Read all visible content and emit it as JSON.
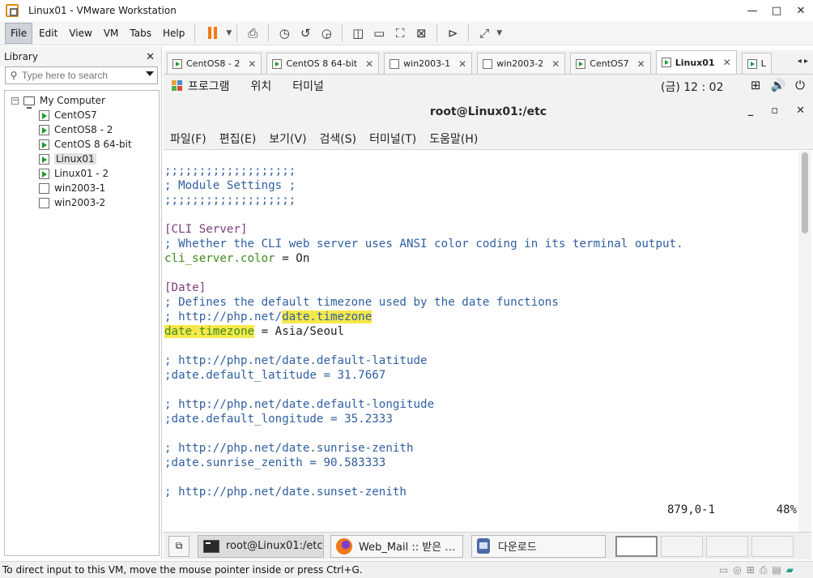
{
  "window": {
    "title": "Linux01 - VMware Workstation",
    "min": "—",
    "max": "□",
    "close": "✕"
  },
  "menu": {
    "file": "File",
    "edit": "Edit",
    "view": "View",
    "vm": "VM",
    "tabs": "Tabs",
    "help": "Help"
  },
  "library": {
    "title": "Library",
    "close": "✕",
    "search_placeholder": "Type here to search",
    "root": "My Computer",
    "items": [
      {
        "label": "CentOS7",
        "running": true
      },
      {
        "label": "CentOS8 - 2",
        "running": true
      },
      {
        "label": "CentOS 8 64-bit",
        "running": true
      },
      {
        "label": "Linux01",
        "running": true,
        "selected": true
      },
      {
        "label": "Linux01 - 2",
        "running": true
      },
      {
        "label": "win2003-1",
        "running": false
      },
      {
        "label": "win2003-2",
        "running": false
      }
    ]
  },
  "tabs": [
    {
      "label": "CentOS8 - 2",
      "close": "✕"
    },
    {
      "label": "CentOS 8 64-bit",
      "close": "✕"
    },
    {
      "label": "win2003-1",
      "close": "✕"
    },
    {
      "label": "win2003-2",
      "close": "✕"
    },
    {
      "label": "CentOS7",
      "close": "✕"
    },
    {
      "label": "Linux01",
      "close": "✕",
      "active": true
    },
    {
      "label": "L",
      "close": "✕"
    }
  ],
  "tab_arrows": "◂ ▸",
  "guest": {
    "panel": {
      "programs": "프로그램",
      "places": "위치",
      "terminal": "터미널",
      "clock": "(금) 12 : 02"
    },
    "terminal_title": "root@Linux01:/etc",
    "terminal_menu": {
      "file": "파일(F)",
      "edit": "편집(E)",
      "view": "보기(V)",
      "search": "검색(S)",
      "terminal": "터미널(T)",
      "help": "도움말(H)"
    },
    "editor": {
      "l01": ";;;;;;;;;;;;;;;;;;;",
      "l02": "; Module Settings ;",
      "l03": ";;;;;;;;;;;;;;;;;;;",
      "l05": "[CLI Server]",
      "l06": "; Whether the CLI web server uses ANSI color coding in its terminal output.",
      "l07_key": "cli_server.color",
      "l07_eq": " = ",
      "l07_val": "On",
      "l09": "[Date]",
      "l10": "; Defines the default timezone used by the date functions",
      "l11_pre": "; http://php.net/",
      "l11_hl": "date.timezone",
      "l12_key": "date.timezone",
      "l12_eq": " = ",
      "l12_val": "Asia/Seoul",
      "l14": "; http://php.net/date.default-latitude",
      "l15": ";date.default_latitude = 31.7667",
      "l17": "; http://php.net/date.default-longitude",
      "l18": ";date.default_longitude = 35.2333",
      "l20": "; http://php.net/date.sunrise-zenith",
      "l21": ";date.sunrise_zenith = 90.583333",
      "l23": "; http://php.net/date.sunset-zenith",
      "cursor_pos": "879,0-1",
      "percent": "48%"
    },
    "taskbar": {
      "terminal_task": "root@Linux01:/etc",
      "browser_task": "Web_Mail :: 받은 …",
      "files_task": "다운로드"
    }
  },
  "status_text": "To direct input to this VM, move the mouse pointer inside or press Ctrl+G."
}
